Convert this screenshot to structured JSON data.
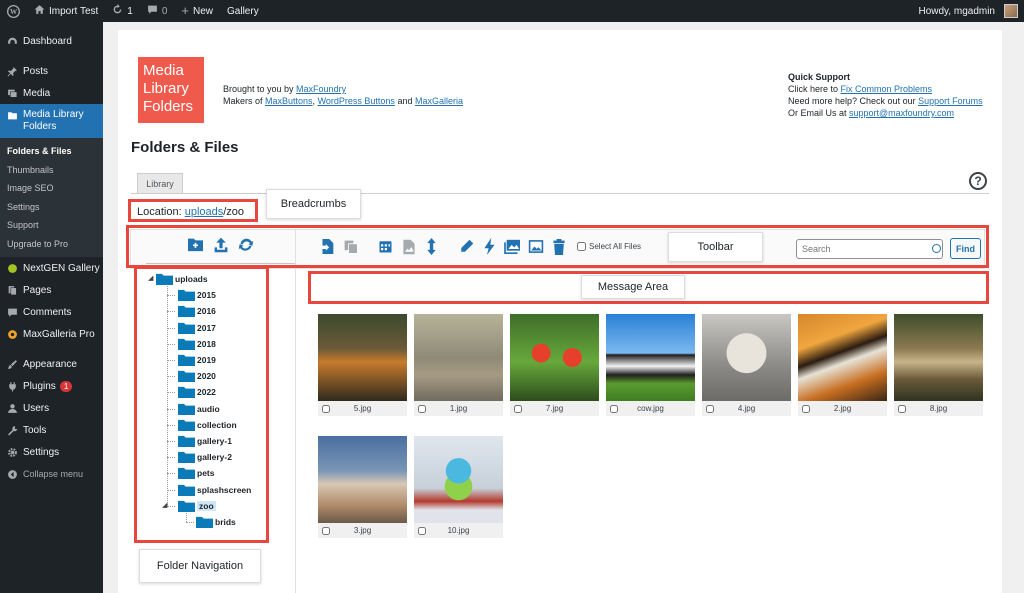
{
  "adminbar": {
    "site_name": "Import Test",
    "updates_count": "1",
    "comments_count": "0",
    "new_label": "New",
    "gallery_label": "Gallery",
    "howdy": "Howdy, mgadmin"
  },
  "sidebar": {
    "items": [
      {
        "label": "Dashboard",
        "icon": "dashboard-icon"
      },
      {
        "label": "Posts",
        "icon": "pin-icon"
      },
      {
        "label": "Media",
        "icon": "media-icon"
      },
      {
        "label": "Media Library Folders",
        "icon": "folders-icon"
      },
      {
        "label": "NextGEN Gallery",
        "icon": "nextgen-icon"
      },
      {
        "label": "Pages",
        "icon": "page-icon"
      },
      {
        "label": "Comments",
        "icon": "comment-icon"
      },
      {
        "label": "MaxGalleria Pro",
        "icon": "maxgalleria-icon"
      },
      {
        "label": "Appearance",
        "icon": "brush-icon"
      },
      {
        "label": "Plugins",
        "icon": "plugin-icon",
        "badge": "1"
      },
      {
        "label": "Users",
        "icon": "user-icon"
      },
      {
        "label": "Tools",
        "icon": "wrench-icon"
      },
      {
        "label": "Settings",
        "icon": "settings-icon"
      },
      {
        "label": "Collapse menu",
        "icon": "collapse-icon"
      }
    ],
    "submenu": [
      "Folders & Files",
      "Thumbnails",
      "Image SEO",
      "Settings",
      "Support",
      "Upgrade to Pro"
    ]
  },
  "header": {
    "logo_lines": [
      "Media",
      "Library",
      "Folders"
    ],
    "brought_prefix": "Brought to you by ",
    "brought_link": "MaxFoundry",
    "makers_prefix": "Makers of ",
    "makers_link1": "MaxButtons",
    "makers_sep": ", ",
    "makers_link2": "WordPress Buttons",
    "makers_and": " and ",
    "makers_link3": "MaxGalleria"
  },
  "support": {
    "title": "Quick Support",
    "line1_prefix": "Click here to ",
    "line1_link": "Fix Common Problems",
    "line2_prefix": "Need more help? Check out our ",
    "line2_link": "Support Forums",
    "line3_prefix": "Or Email Us at ",
    "line3_link": "support@maxfoundry.com"
  },
  "page": {
    "heading": "Folders & Files",
    "tab_library": "Library",
    "help_label": "?",
    "location_label": "Location: ",
    "location_link": "uploads",
    "location_rest": "/zoo"
  },
  "toolbar": {
    "select_all_label": "Select All Files",
    "search_placeholder": "Search",
    "find_label": "Find"
  },
  "tree": {
    "root": "uploads",
    "folders": [
      "2015",
      "2016",
      "2017",
      "2018",
      "2019",
      "2020",
      "2022",
      "audio",
      "collection",
      "gallery-1",
      "gallery-2",
      "pets",
      "splashscreen",
      "zoo"
    ],
    "selected": "zoo",
    "subfolder": "brids"
  },
  "files": [
    {
      "name": "5.jpg"
    },
    {
      "name": "1.jpg"
    },
    {
      "name": "7.jpg"
    },
    {
      "name": "cow.jpg"
    },
    {
      "name": "4.jpg"
    },
    {
      "name": "2.jpg"
    },
    {
      "name": "8.jpg"
    },
    {
      "name": "3.jpg"
    },
    {
      "name": "10.jpg"
    }
  ],
  "annotations": {
    "breadcrumbs": "Breadcrumbs",
    "toolbar": "Toolbar",
    "message_area": "Message Area",
    "folder_navigation": "Folder Navigation"
  },
  "colors": {
    "wp_dark": "#1d2327",
    "wp_blue": "#2271b1",
    "folder_blue": "#0a7ab8",
    "callout_red": "#e8473d",
    "logo_red": "#f05a4c"
  }
}
